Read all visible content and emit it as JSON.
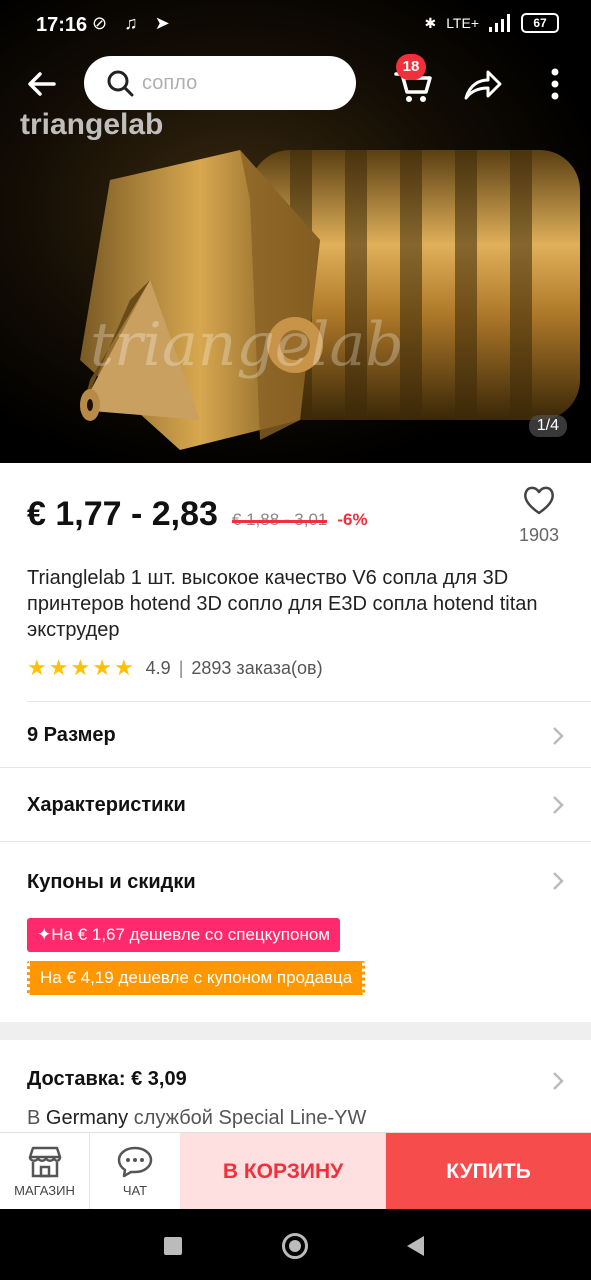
{
  "status": {
    "time": "17:16",
    "battery": "67",
    "network": "LTE+",
    "left_icons": "⊘ ♫ ➤"
  },
  "search": {
    "placeholder": "сопло"
  },
  "cart": {
    "badge": "18"
  },
  "image": {
    "counter": "1/4",
    "watermark_top": "triangelab",
    "watermark_mid": "triangelab"
  },
  "price": {
    "current": "€ 1,77 - 2,83",
    "old": "€ 1,88 - 3,01",
    "discount": "-6%"
  },
  "wishlist": {
    "count": "1903"
  },
  "product": {
    "title": "Trianglelab 1 шт. высокое качество V6 сопла для 3D принтеров hotend 3D сопло для E3D сопла hotend titan экструдер",
    "rating": "4.9",
    "orders": "2893 заказа(ов)",
    "stars": 5
  },
  "rows": {
    "size": "9 Размер",
    "specs": "Характеристики",
    "coupons": "Купоны и скидки"
  },
  "coupons": {
    "special": "✦На € 1,67 дешевле со спецкупоном",
    "seller": "На € 4,19 дешевле с купоном продавца"
  },
  "delivery": {
    "label": "Доставка: € 3,09",
    "prefix": "В",
    "country": "Germany",
    "service": "службой Special Line-YW"
  },
  "bottom": {
    "store": "МАГАЗИН",
    "chat": "ЧАТ",
    "add_to_cart": "В КОРЗИНУ",
    "buy": "КУПИТЬ"
  },
  "colors": {
    "accent": "#f2303b",
    "buy_bg": "#f74c4c",
    "cart_bg": "#ffe0e0",
    "coupon_pink": "#ff2a6d",
    "coupon_orange": "#ff9800",
    "star": "#ffc107"
  }
}
